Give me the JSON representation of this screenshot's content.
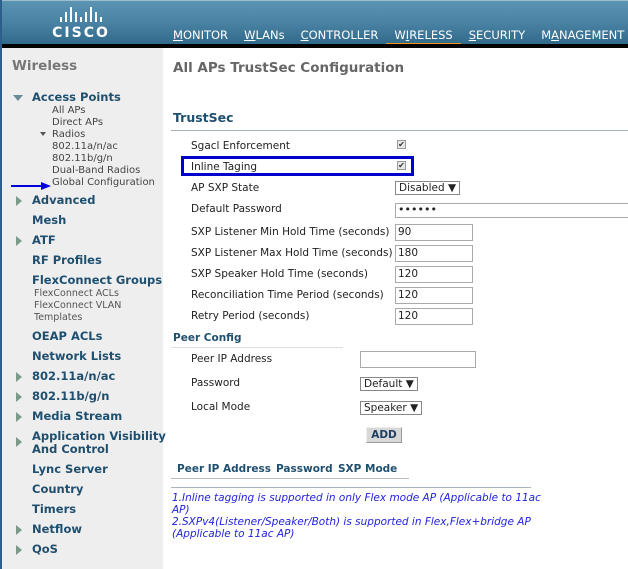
{
  "header": {
    "logo_text": "CISCO",
    "nav": [
      {
        "label": "MONITOR",
        "accel": "M",
        "rest": "ONITOR",
        "active": false
      },
      {
        "label": "WLANs",
        "accel": "W",
        "rest": "LANs",
        "active": false
      },
      {
        "label": "CONTROLLER",
        "accel": "C",
        "rest": "ONTROLLER",
        "active": false
      },
      {
        "label": "WIRELESS",
        "pre": "W",
        "accel": "I",
        "rest": "RELESS",
        "active": true
      },
      {
        "label": "SECURITY",
        "accel": "S",
        "rest": "ECURITY",
        "active": false
      },
      {
        "label": "MANAGEMENT",
        "pre": "M",
        "accel": "A",
        "rest": "NAGEMENT",
        "active": false
      }
    ],
    "active_accent": "#f7941d"
  },
  "sidebar": {
    "title": "Wireless",
    "access_points": {
      "label": "Access Points",
      "children": [
        "All APs",
        "Direct APs"
      ],
      "radios": {
        "label": "Radios",
        "children": [
          "802.11a/n/ac",
          "802.11b/g/n",
          "Dual-Band Radios"
        ]
      },
      "global_config": "Global Configuration"
    },
    "items": [
      {
        "label": "Advanced",
        "expandable": true
      },
      {
        "label": "Mesh",
        "expandable": false
      },
      {
        "label": "ATF",
        "expandable": true
      },
      {
        "label": "RF Profiles",
        "expandable": false
      },
      {
        "label": "FlexConnect Groups",
        "expandable": false
      },
      {
        "label": "OEAP ACLs",
        "expandable": false
      },
      {
        "label": "Network Lists",
        "expandable": false
      },
      {
        "label": "802.11a/n/ac",
        "expandable": true
      },
      {
        "label": "802.11b/g/n",
        "expandable": true
      },
      {
        "label": "Media Stream",
        "expandable": true
      },
      {
        "label": "Application Visibility",
        "label2": "And Control",
        "expandable": true
      },
      {
        "label": "Lync Server",
        "expandable": false
      },
      {
        "label": "Country",
        "expandable": false
      },
      {
        "label": "Timers",
        "expandable": false
      },
      {
        "label": "Netflow",
        "expandable": true
      },
      {
        "label": "QoS",
        "expandable": true
      }
    ],
    "flex_children": [
      "FlexConnect ACLs",
      "FlexConnect VLAN",
      "Templates"
    ]
  },
  "main": {
    "page_title": "All APs TrustSec Configuration",
    "section_title": "TrustSec",
    "sgacl": {
      "label": "Sgacl Enforcement",
      "checked": true
    },
    "inline": {
      "label": "Inline Taging",
      "checked": true
    },
    "ap_sxp_state": {
      "label": "AP SXP State",
      "value": "Disabled"
    },
    "default_password": {
      "label": "Default Password",
      "value": "••••••"
    },
    "fields": [
      {
        "label": "SXP Listener Min Hold Time (seconds)",
        "value": "90"
      },
      {
        "label": "SXP Listener Max Hold Time (seconds)",
        "value": "180"
      },
      {
        "label": "SXP Speaker Hold Time (seconds)",
        "value": "120"
      },
      {
        "label": "Reconciliation Time Period (seconds)",
        "value": "120"
      },
      {
        "label": "Retry Period (seconds)",
        "value": "120"
      }
    ],
    "peer_config": {
      "title": "Peer Config",
      "peer_ip_label": "Peer IP Address",
      "peer_ip_value": "",
      "password_label": "Password",
      "password_value": "Default",
      "local_mode_label": "Local Mode",
      "local_mode_value": "Speaker",
      "add_label": "ADD"
    },
    "table_headers": [
      "Peer IP Address",
      "Password",
      "SXP Mode"
    ],
    "notes": [
      "1.Inline tagging is supported in only Flex mode AP (Applicable to 11ac AP)",
      "2.SXPv4(Listener/Speaker/Both) is supported in Flex,Flex+bridge AP (Applicable to 11ac AP)"
    ],
    "highlight_color": "#0000cc"
  }
}
